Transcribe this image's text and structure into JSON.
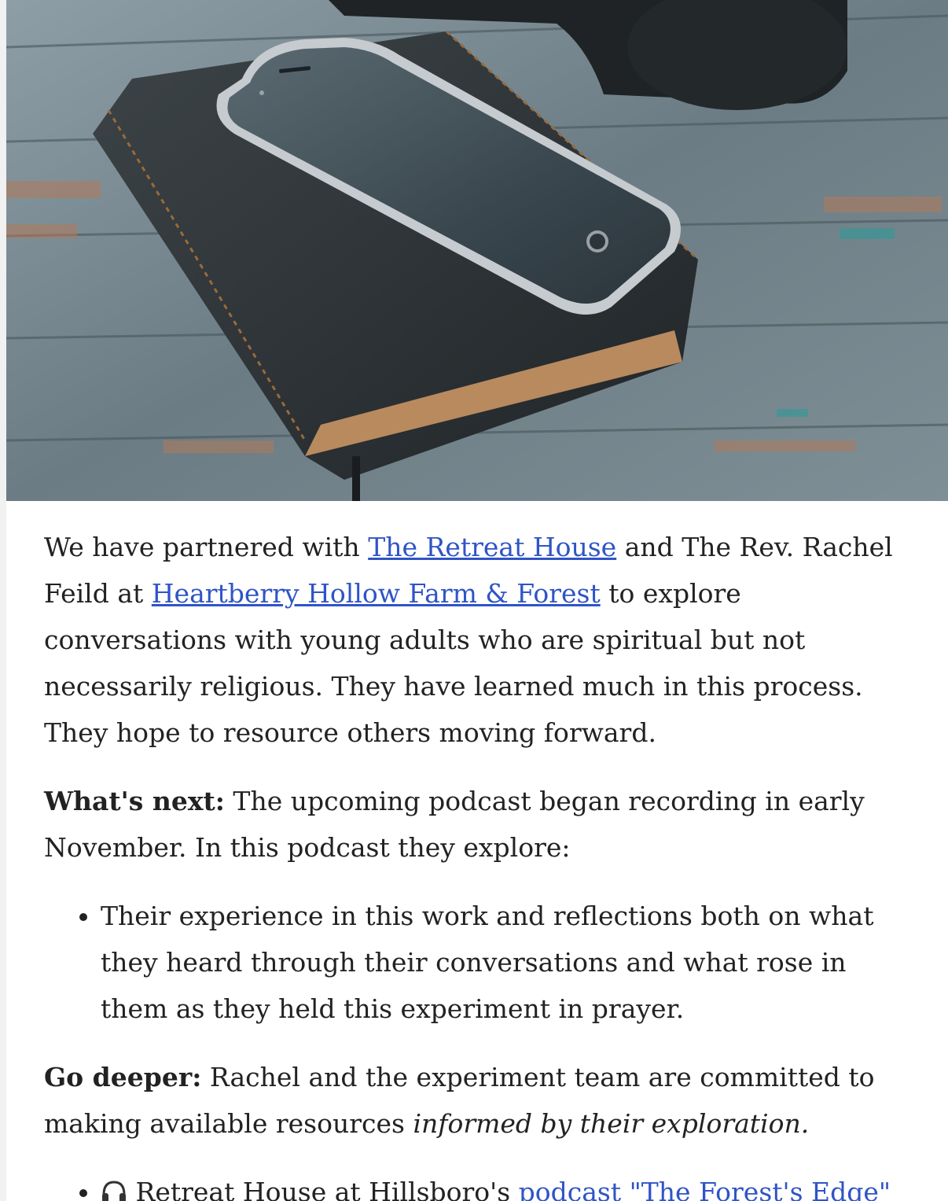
{
  "hero_image": {
    "alt": "",
    "icon": "phone-on-bible-photo"
  },
  "intro": {
    "text_before_link1": "We have partnered with ",
    "link1": "The Retreat House",
    "text_between_links": " and The Rev. Rachel Feild at ",
    "link2": "Heartberry Hollow Farm & Forest",
    "text_after_link2": " to explore conversations with young adults who are spiritual but not necessarily religious. They have learned much in this process. They hope to resource others moving forward."
  },
  "whats_next": {
    "label": "What's next:",
    "text": " The upcoming podcast began recording in early November. In this podcast they explore:",
    "items": [
      "Their experience in this work and reflections both on what they heard through their conversations and what rose in them as they held this experiment in prayer."
    ]
  },
  "go_deeper": {
    "label": "Go deeper:",
    "text": " Rachel and the experiment team are committed to making available resources ",
    "emphasis": "informed by their exploration.",
    "resources": [
      {
        "icon": "headphones-icon",
        "text": " Retreat House at Hillsboro's ",
        "link": "podcast \"The Forest's Edge\""
      }
    ]
  },
  "colors": {
    "link": "#2f54c6",
    "text": "#222222",
    "background": "#ffffff"
  }
}
